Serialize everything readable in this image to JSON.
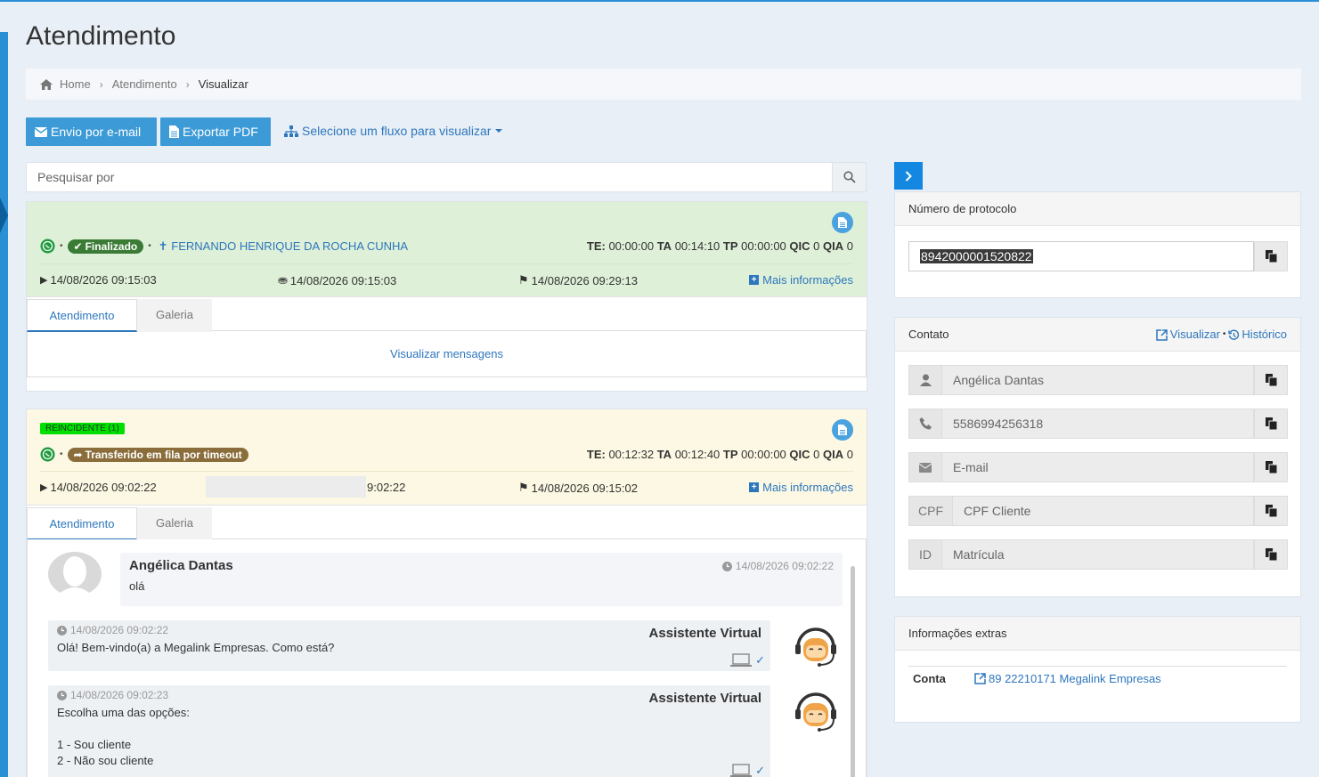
{
  "page": {
    "title": "Atendimento"
  },
  "breadcrumb": {
    "home": "Home",
    "section": "Atendimento",
    "current": "Visualizar"
  },
  "toolbar": {
    "email_label": "Envio por e-mail",
    "pdf_label": "Exportar PDF",
    "flow_label": "Selecione um fluxo para visualizar"
  },
  "search": {
    "placeholder": "Pesquisar por"
  },
  "attendance1": {
    "status": "Finalizado",
    "contact": "FERNANDO HENRIQUE DA ROCHA CUNHA",
    "metrics": {
      "te_label": "TE:",
      "te": "00:00:00",
      "ta_label": "TA",
      "ta": "00:14:10",
      "tp_label": "TP",
      "tp": "00:00:00",
      "qic_label": "QIC",
      "qic": "0",
      "qia_label": "QIA",
      "qia": "0"
    },
    "start": "14/08/2026 09:15:03",
    "first_msg": "14/08/2026 09:15:03",
    "end": "14/08/2026 09:29:13",
    "more": "Mais informações",
    "tabs": [
      "Atendimento",
      "Galeria"
    ],
    "view_messages": "Visualizar mensagens"
  },
  "attendance2": {
    "reincident": "REINCIDENTE (1)",
    "status": "Transferido em fila por timeout",
    "metrics": {
      "te_label": "TE:",
      "te": "00:12:32",
      "ta_label": "TA",
      "ta": "00:12:40",
      "tp_label": "TP",
      "tp": "00:00:00",
      "qic_label": "QIC",
      "qic": "0",
      "qia_label": "QIA",
      "qia": "0"
    },
    "start": "14/08/2026 09:02:22",
    "first_msg_partial": "9:02:22",
    "end": "14/08/2026 09:15:02",
    "more": "Mais informações",
    "tabs": [
      "Atendimento",
      "Galeria"
    ],
    "messages": [
      {
        "sender": "Angélica Dantas",
        "time": "14/08/2026 09:02:22",
        "text": "olá"
      },
      {
        "sender": "Assistente Virtual",
        "time": "14/08/2026 09:02:22",
        "text": "Olá! Bem-vindo(a) a Megalink Empresas. Como está?"
      },
      {
        "sender": "Assistente Virtual",
        "time": "14/08/2026 09:02:23",
        "text": "Escolha uma das opções:\n\n1 - Sou cliente\n2 - Não sou cliente"
      }
    ]
  },
  "protocol": {
    "heading": "Número de protocolo",
    "value": "8942000001520822"
  },
  "contact": {
    "heading": "Contato",
    "view_link": "Visualizar",
    "history_link": "Histórico",
    "name": "Angélica Dantas",
    "phone": "5586994256318",
    "email_placeholder": "E-mail",
    "cpf_addon": "CPF",
    "cpf_placeholder": "CPF Cliente",
    "id_addon": "ID",
    "id_placeholder": "Matrícula"
  },
  "extras": {
    "heading": "Informações extras",
    "key": "Conta",
    "value": "89 22210171 Megalink Empresas"
  },
  "colors": {
    "accent": "#3c9ad6",
    "link": "#2d77bd",
    "finalizado": "#3a7b35",
    "transfer": "#8a6d3b",
    "reincident": "#00e000"
  }
}
